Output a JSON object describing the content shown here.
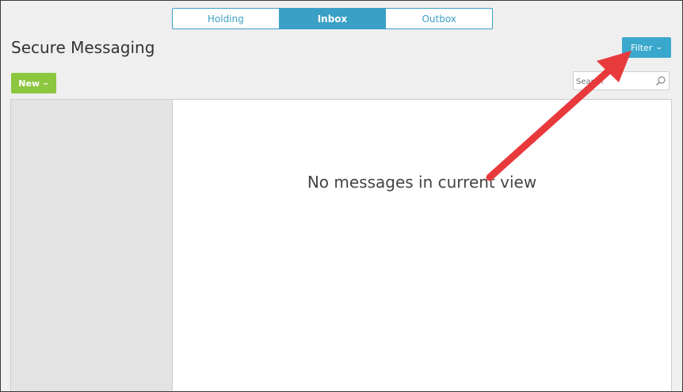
{
  "tabs": [
    {
      "label": "Holding",
      "active": false
    },
    {
      "label": "Inbox",
      "active": true
    },
    {
      "label": "Outbox",
      "active": false
    }
  ],
  "page_title": "Secure Messaging",
  "toolbar": {
    "filter_label": "Filter",
    "new_label": "New"
  },
  "search": {
    "placeholder": "Search",
    "value": ""
  },
  "main": {
    "empty_message": "No messages in current view"
  },
  "colors": {
    "accent": "#3aa8cc",
    "new_button": "#8dc63f",
    "annotation_arrow": "#e8393d"
  },
  "icons": {
    "search": "magnifier-icon",
    "dropdown": "chevron-down-icon"
  }
}
